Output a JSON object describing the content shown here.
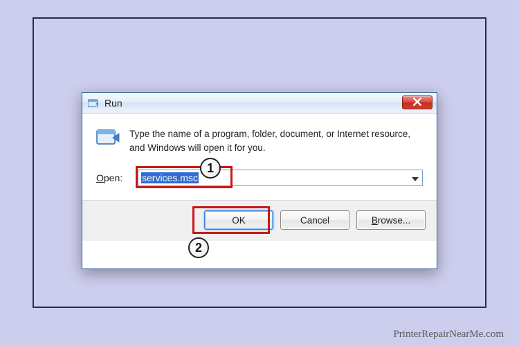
{
  "dialog": {
    "title": "Run",
    "instruction": "Type the name of a program, folder, document, or Internet resource, and Windows will open it for you.",
    "open_label_pre": "",
    "open_label_accel": "O",
    "open_label_post": "pen:",
    "input_value": "services.msc",
    "buttons": {
      "ok": "OK",
      "cancel": "Cancel",
      "browse_accel": "B",
      "browse_rest": "rowse..."
    }
  },
  "callouts": {
    "step1": "1",
    "step2": "2"
  },
  "watermark": "PrinterRepairNearMe.com"
}
